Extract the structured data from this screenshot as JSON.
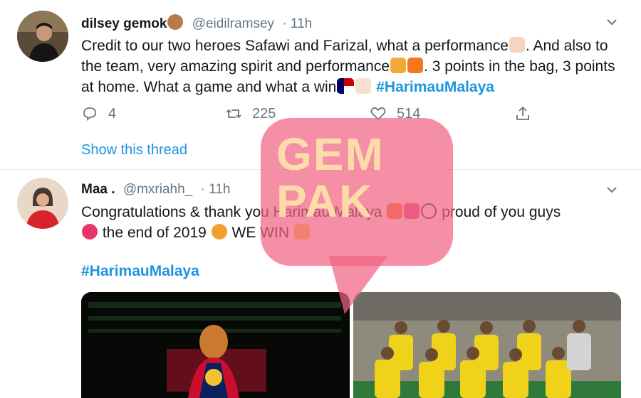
{
  "tweets": [
    {
      "name": "dilsey gemok",
      "handle": "@eidilramsey",
      "time": "· 11h",
      "text_lines": [
        "Credit to our two heroes Safawi and Farizal, what a performance",
        ". And also to the team, very amazing spirit and performance",
        ". 3 points in the bag, 3 points at home. What a game and what a win"
      ],
      "hashtag": "#HarimauMalaya",
      "reply_count": "4",
      "retweet_count": "225",
      "like_count": "514",
      "show_thread": "Show this thread",
      "icons": [
        "bear-emoji",
        "clapping-hands-emoji",
        "tiger-emoji",
        "fire-emoji",
        "malaysia-flag-emoji",
        "victory-hand-emoji"
      ]
    },
    {
      "name": "Maa .",
      "handle": "@mxriahh_",
      "time": "· 11h",
      "text_line1": "Congratulations & thank you Harimau Malaya",
      "text_line1_end": "proud of you guys",
      "text_line2_mid": "the end of 2019",
      "text_line2_end": "WE WIN",
      "hashtag": "#HarimauMalaya",
      "icons": [
        "fire-emoji",
        "party-popper-emoji",
        "soccer-ball-emoji",
        "two-hearts-emoji",
        "lion-emoji",
        "clapping-hands-emoji"
      ]
    }
  ],
  "watermark": {
    "line1": "GEM",
    "line2": "PAK"
  },
  "colors": {
    "link": "#1b95e0",
    "secondary": "#657786",
    "watermark": "#f06482"
  }
}
